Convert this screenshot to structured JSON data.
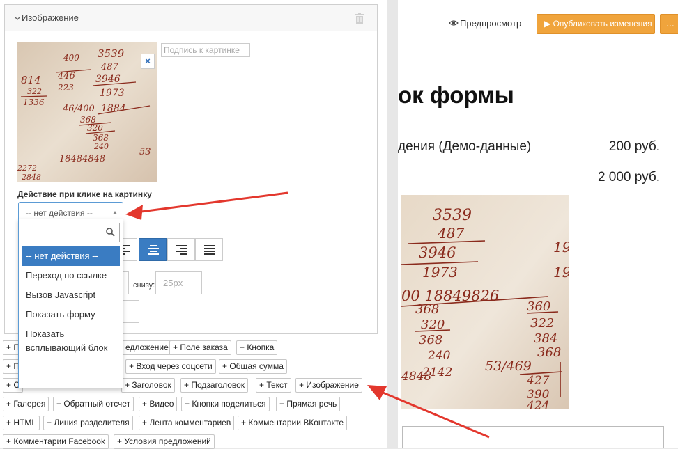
{
  "panel": {
    "title": "Изображение"
  },
  "image": {
    "caption_placeholder": "Подпись к картинке",
    "close_label": "×"
  },
  "click_action": {
    "label": "Действие при клике на картинку",
    "selected": "-- нет действия --",
    "options": [
      "-- нет действия --",
      "Переход по ссылке",
      "Вызов Javascript",
      "Показать форму",
      "Показать всплывающий блок"
    ]
  },
  "padding": {
    "bottom_label": "снизу:",
    "bottom_placeholder": "25px"
  },
  "blocks": [
    "+ П",
    "едложение",
    "+ Поле заказа",
    "+ Кнопка",
    "+ П",
    "+ Вход через соцсети",
    "+ Общая сумма",
    "+ С",
    "+ Заголовок",
    "+ Подзаголовок",
    "+ Текст",
    "+ Изображение",
    "+ Галерея",
    "+ Обратный отсчет",
    "+ Видео",
    "+ Кнопки поделиться",
    "+ Прямая речь",
    "+ HTML",
    "+ Линия разделителя",
    "+ Лента комментариев",
    "+ Комментарии ВКонтакте",
    "+ Комментарии Facebook",
    "+ Условия предложений"
  ],
  "preview": {
    "preview_label": "Предпросмотр",
    "publish_label": "▶ Опубликовать изменения",
    "more_label": "...",
    "form_title": "ок формы",
    "rows": [
      {
        "name": "дения (Демо-данные)",
        "price": "200 руб."
      },
      {
        "name": "",
        "price": "2 000 руб."
      }
    ]
  },
  "colors": {
    "accent": "#3a7cc2",
    "publish": "#f0a43c",
    "arrow": "#e3372d"
  }
}
